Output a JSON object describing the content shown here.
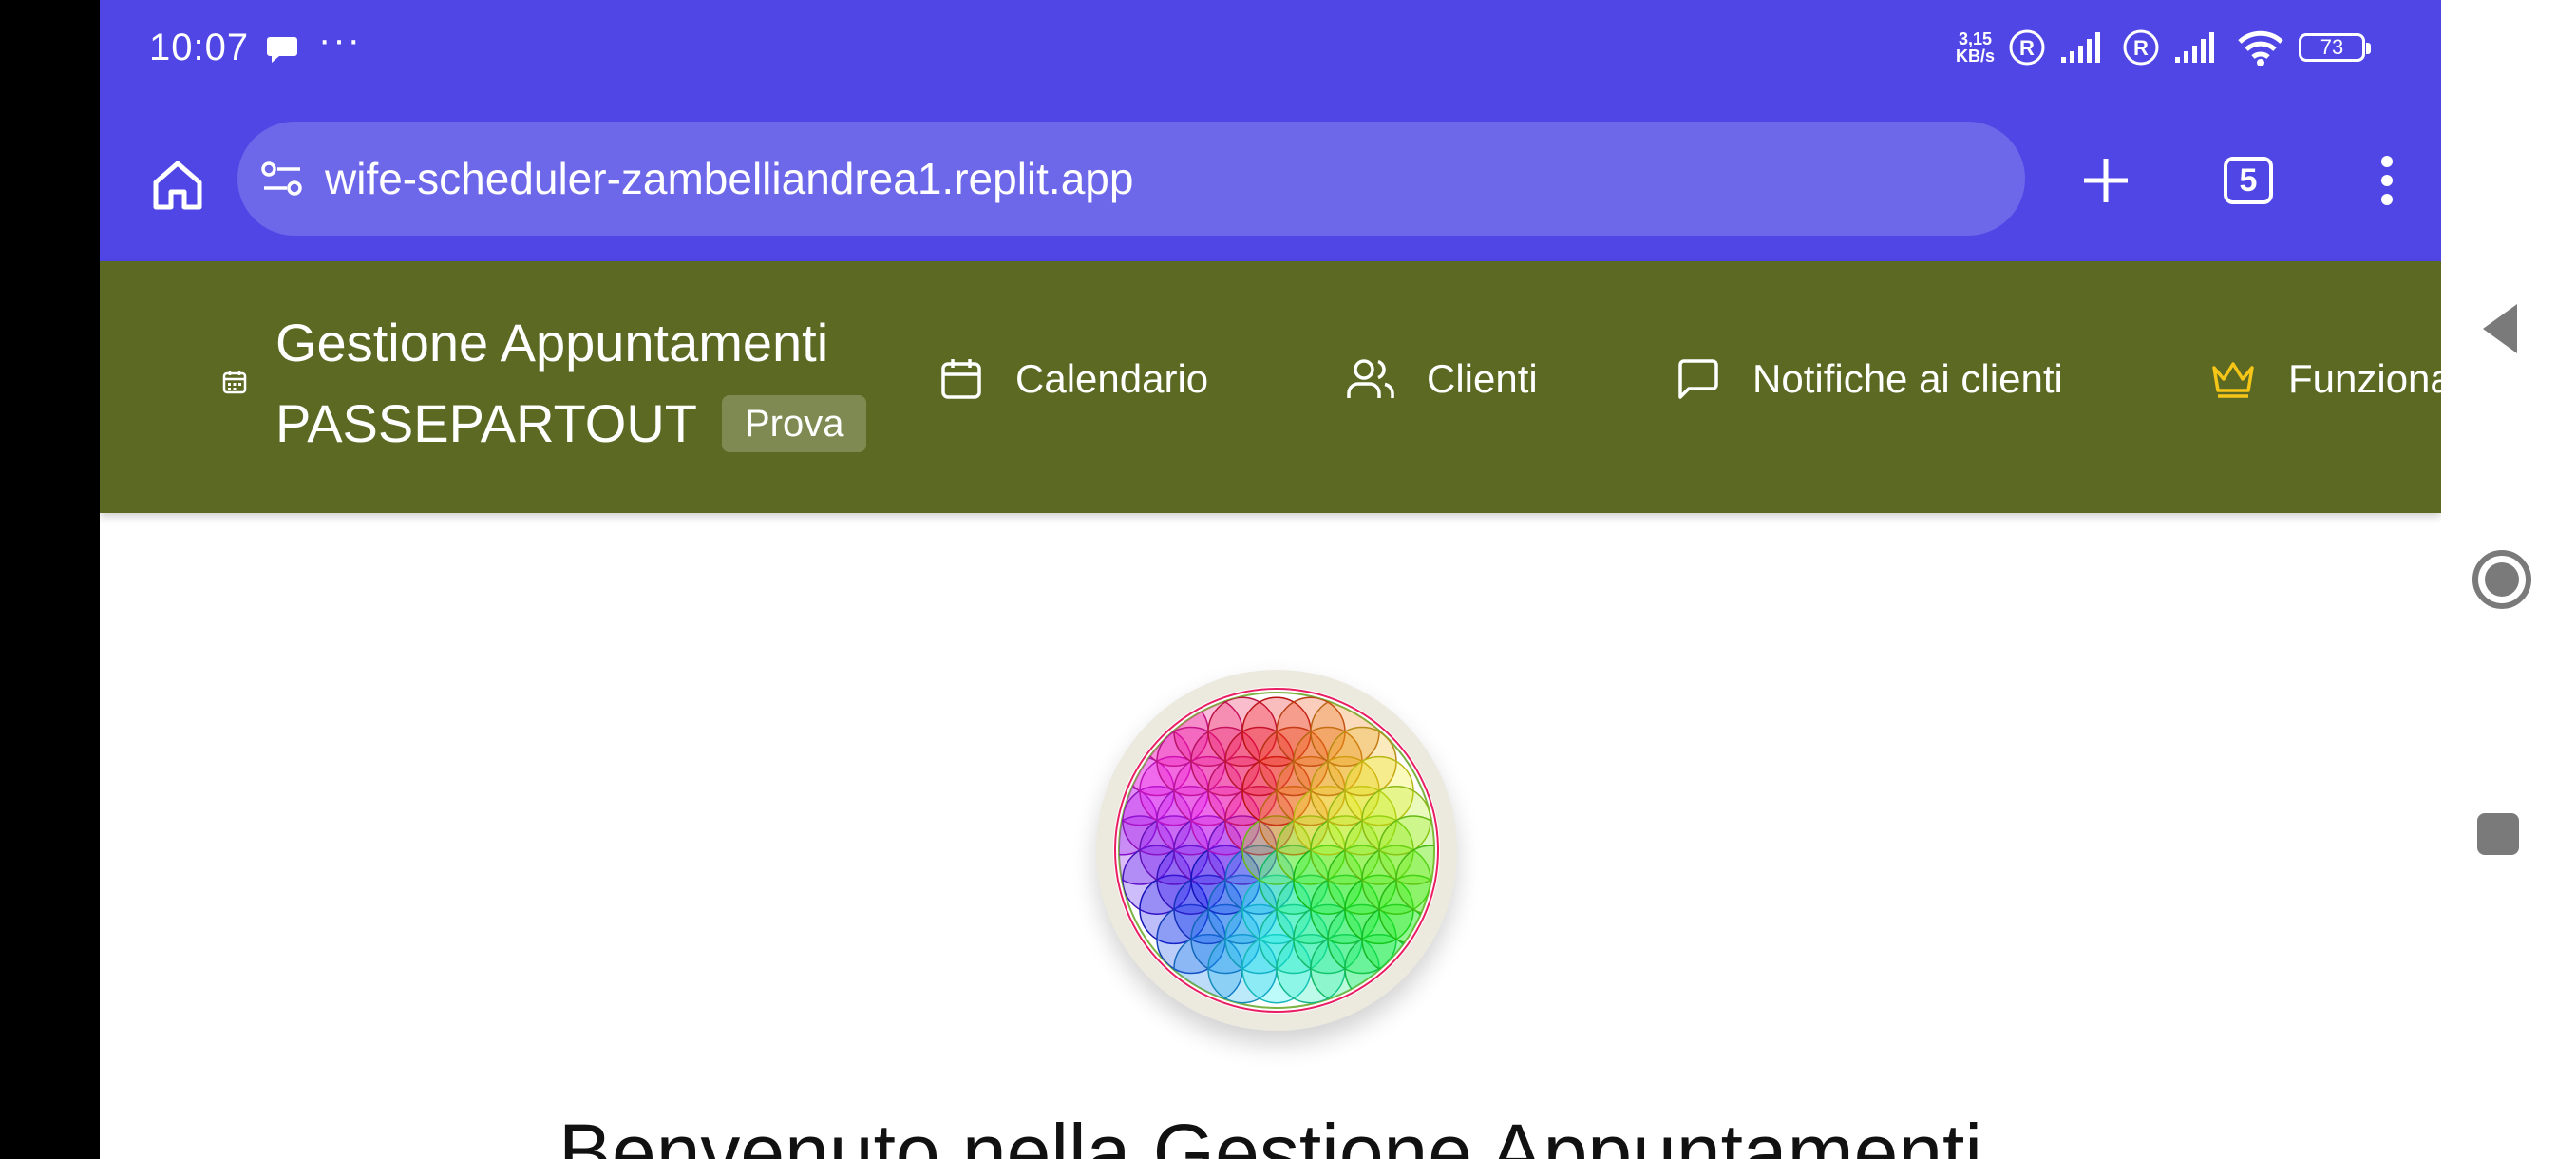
{
  "status_bar": {
    "time": "10:07",
    "more": "···",
    "net_speed_value": "3,15",
    "net_speed_unit": "KB/s",
    "sim1_label": "R",
    "sim2_label": "R",
    "battery": "73"
  },
  "browser": {
    "url": "wife-scheduler-zambelliandrea1.replit.app",
    "tab_count": "5",
    "accent": "#4f46e5"
  },
  "header": {
    "title": "Gestione Appuntamenti",
    "subtitle": "PASSEPARTOUT",
    "badge": "Prova",
    "color": "#5c6923",
    "nav": {
      "calendar": "Calendario",
      "clients": "Clienti",
      "notifications": "Notifiche ai clienti",
      "features": "Funzionalità Premium"
    }
  },
  "main": {
    "logo": "flower-of-life-logo",
    "heading": "Benvenuto nella Gestione Appuntamenti"
  },
  "icons": [
    "home-icon",
    "site-settings-icon",
    "plus-icon",
    "tabs-icon",
    "more-vert-icon",
    "calendar-icon",
    "users-icon",
    "message-icon",
    "crown-icon",
    "back-icon",
    "home-circle-icon",
    "recents-icon"
  ]
}
